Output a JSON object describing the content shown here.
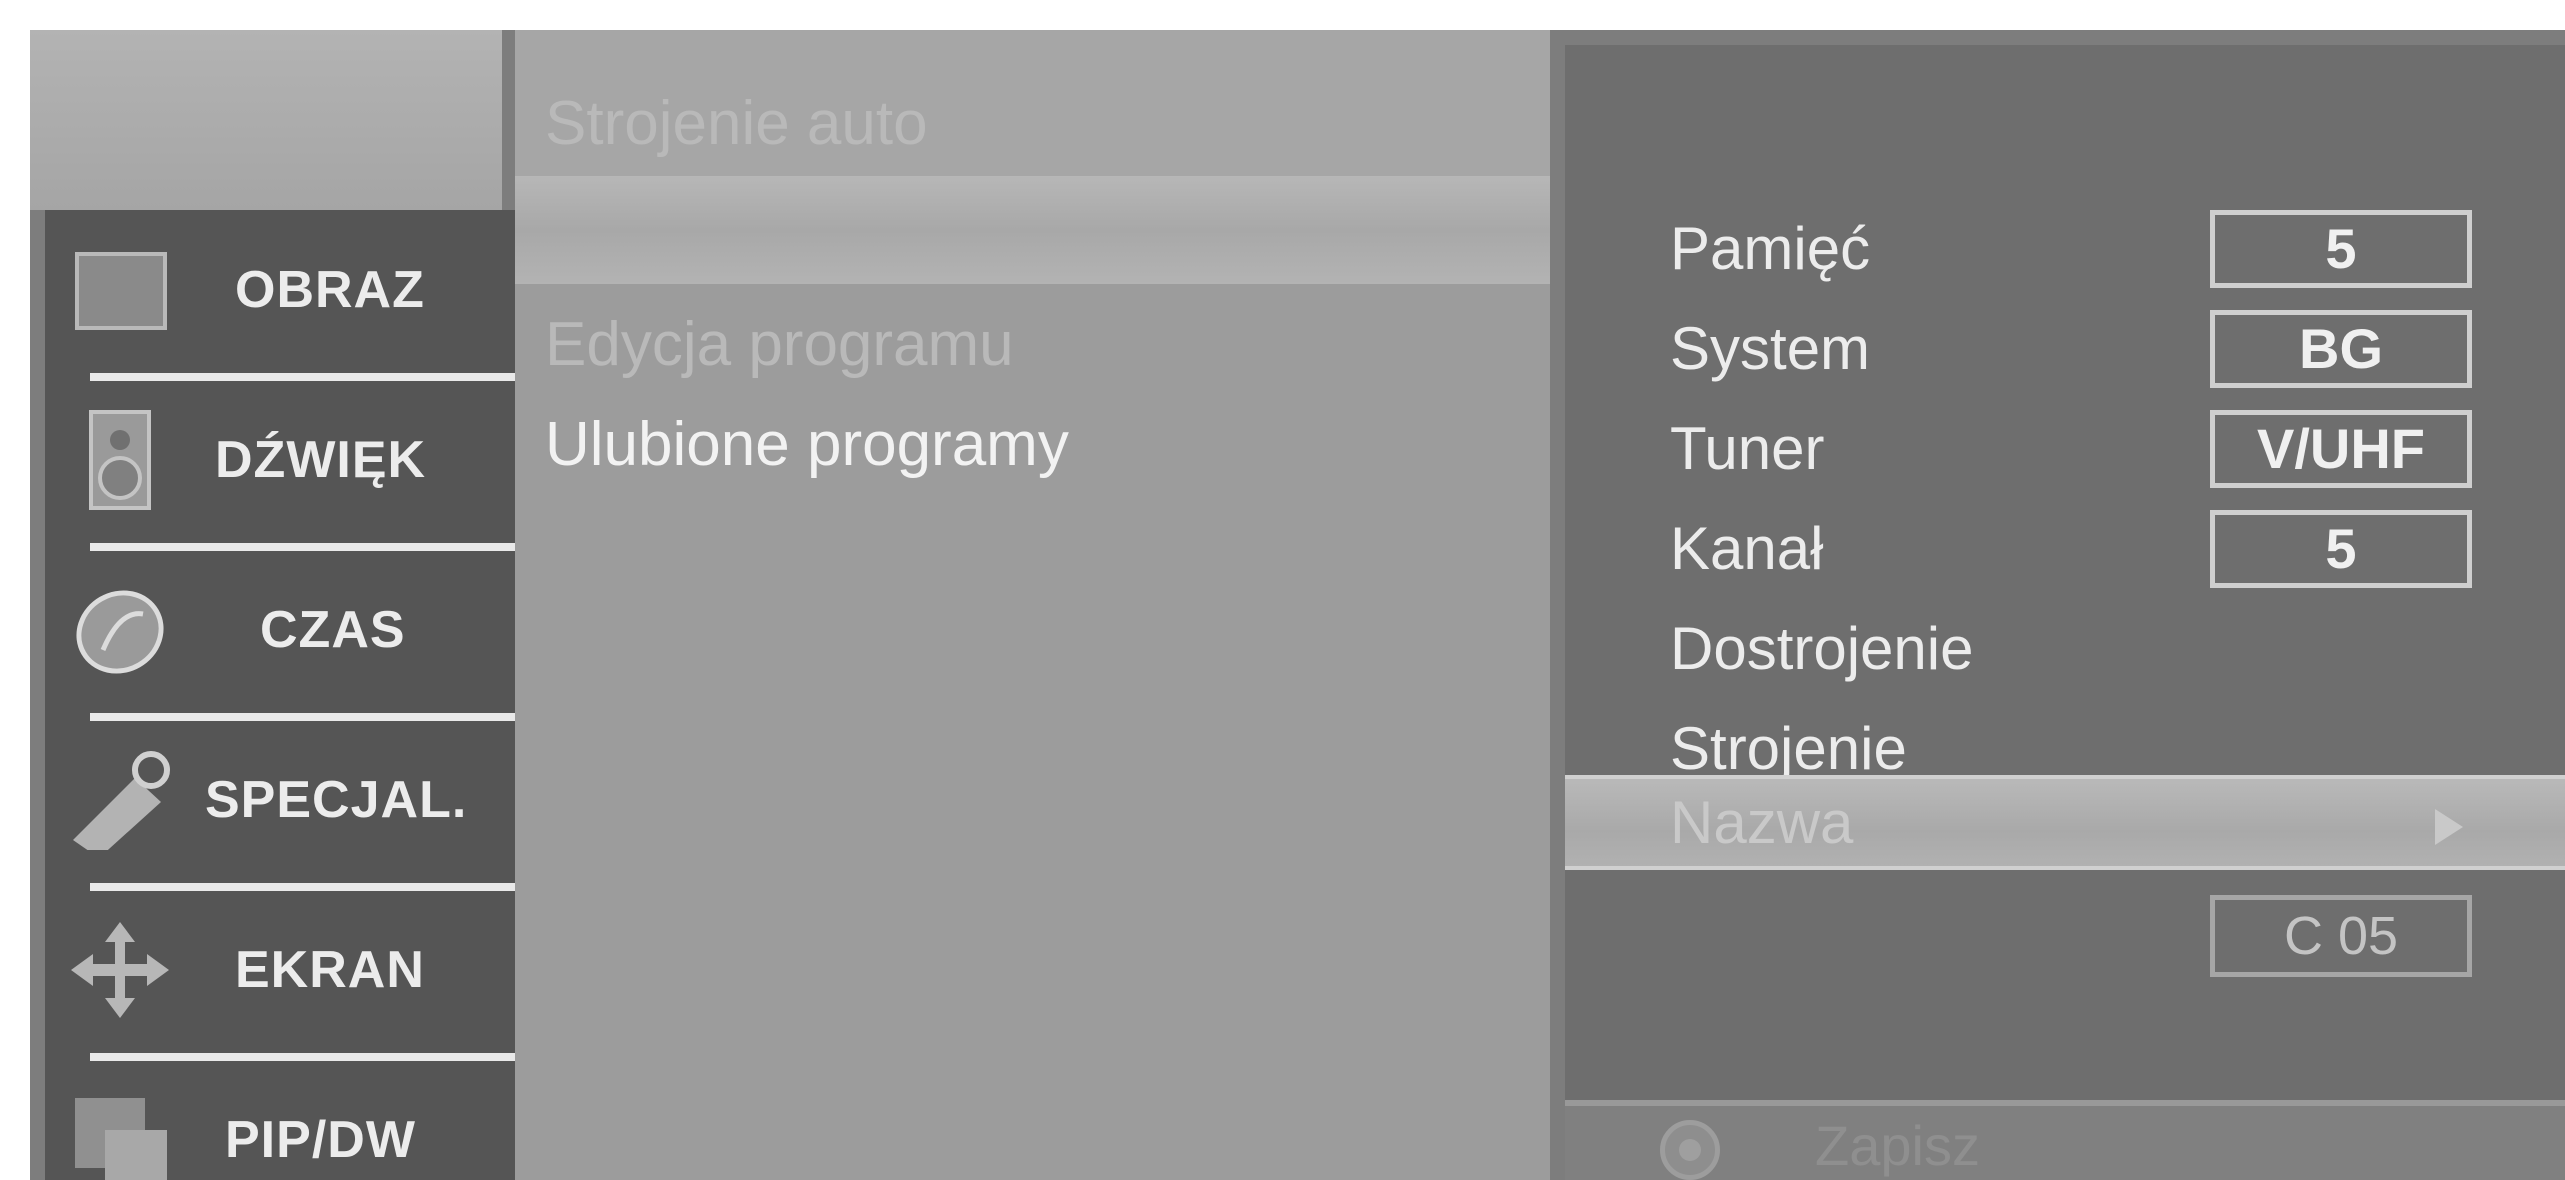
{
  "sidebar": {
    "items": [
      {
        "label": "OBRAZ",
        "icon": "picture-icon"
      },
      {
        "label": "DŹWIĘK",
        "icon": "speaker-icon"
      },
      {
        "label": "CZAS",
        "icon": "clock-icon"
      },
      {
        "label": "SPECJAL.",
        "icon": "tag-icon"
      },
      {
        "label": "EKRAN",
        "icon": "move-arrows-icon"
      },
      {
        "label": "PIP/DW",
        "icon": "pip-icon"
      }
    ]
  },
  "menu": {
    "items": [
      {
        "label": "Strojenie auto"
      },
      {
        "label": ""
      },
      {
        "label": "Edycja programu"
      },
      {
        "label": "Ulubione programy"
      }
    ]
  },
  "submenu": {
    "rows": [
      {
        "label": "Pamięć",
        "value": "5"
      },
      {
        "label": "System",
        "value": "BG"
      },
      {
        "label": "Tuner",
        "value": "V/UHF"
      },
      {
        "label": "Kanał",
        "value": "5"
      },
      {
        "label": "Dostrojenie"
      },
      {
        "label": "Strojenie"
      }
    ],
    "selected": {
      "label": "Nazwa",
      "value": "C 05"
    },
    "footer_label": "Zapisz"
  }
}
